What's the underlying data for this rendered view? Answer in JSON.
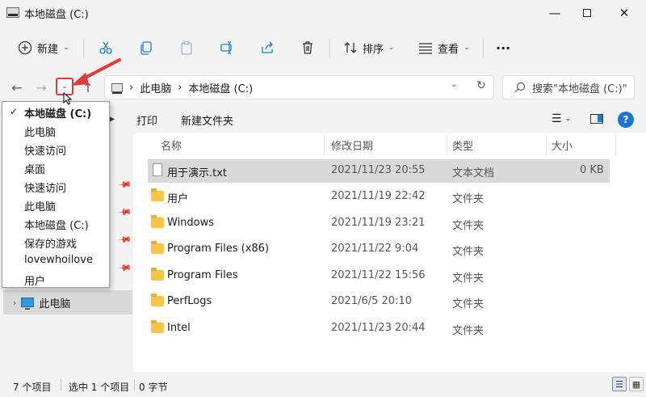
{
  "window": {
    "title": "本地磁盘 (C:)",
    "min": "—",
    "close": "✕"
  },
  "toolbar": {
    "new_label": "新建",
    "sort_label": "排序",
    "view_label": "查看",
    "more_label": "···"
  },
  "address": {
    "crumbs": [
      "此电脑",
      "本地磁盘 (C:)"
    ],
    "sep": "›",
    "search_placeholder": "搜索\"本地磁盘 (C:)\""
  },
  "commands": {
    "print_label": "打印",
    "new_folder_label": "新建文件夹"
  },
  "recent_dropdown": {
    "items": [
      "本地磁盘 (C:)",
      "此电脑",
      "快速访问",
      "桌面",
      "快速访问",
      "此电脑",
      "本地磁盘 (C:)",
      "保存的游戏",
      "lovewhoilove",
      "用户"
    ],
    "checked_index": 0
  },
  "sidebar": {
    "tree_item": "此电脑"
  },
  "columns": {
    "name": "名称",
    "date": "修改日期",
    "type": "类型",
    "size": "大小"
  },
  "files": [
    {
      "name": "用于演示.txt",
      "date": "2021/11/23 20:55",
      "type": "文本文档",
      "size": "0 KB",
      "icon": "txt-file-icon",
      "selected": true
    },
    {
      "name": "用户",
      "date": "2021/11/19 22:42",
      "type": "文件夹",
      "size": "",
      "icon": "folder-icon"
    },
    {
      "name": "Windows",
      "date": "2021/11/19 23:21",
      "type": "文件夹",
      "size": "",
      "icon": "folder-icon"
    },
    {
      "name": "Program Files (x86)",
      "date": "2021/11/22 9:04",
      "type": "文件夹",
      "size": "",
      "icon": "folder-icon"
    },
    {
      "name": "Program Files",
      "date": "2021/11/22 15:56",
      "type": "文件夹",
      "size": "",
      "icon": "folder-icon"
    },
    {
      "name": "PerfLogs",
      "date": "2021/6/5 20:10",
      "type": "文件夹",
      "size": "",
      "icon": "folder-icon"
    },
    {
      "name": "Intel",
      "date": "2021/11/23 20:44",
      "type": "文件夹",
      "size": "",
      "icon": "folder-icon"
    }
  ],
  "status": {
    "count": "7 个项目",
    "selected": "选中 1 个项目",
    "bytes": "0 字节"
  },
  "colors": {
    "highlight": "#e03a3a",
    "help": "#1976d2",
    "folder": "#f7c54a"
  }
}
